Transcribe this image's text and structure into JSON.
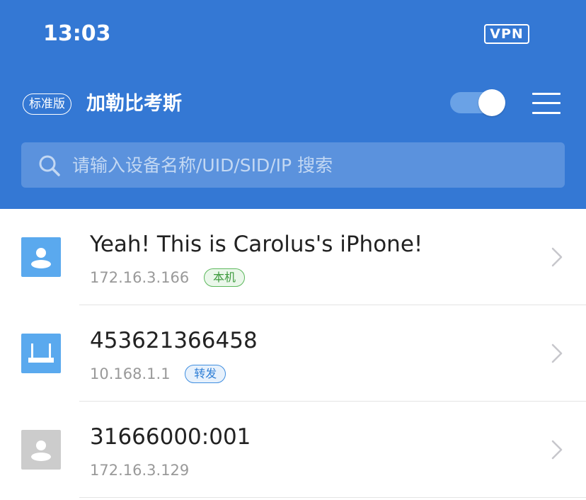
{
  "status_bar": {
    "time": "13:03",
    "vpn_label": "VPN"
  },
  "header": {
    "edition_badge": "标准版",
    "network_name": "加勒比考斯",
    "vpn_toggle_on": true
  },
  "search": {
    "placeholder": "请输入设备名称/UID/SID/IP 搜索",
    "value": ""
  },
  "devices": [
    {
      "name": "Yeah! This is Carolus's iPhone!",
      "ip": "172.16.3.166",
      "tag": "本机",
      "tag_color": "green",
      "icon": "person-icon",
      "icon_color": "#5aa9ee"
    },
    {
      "name": "453621366458",
      "ip": "10.168.1.1",
      "tag": "转发",
      "tag_color": "blue",
      "icon": "router-icon",
      "icon_color": "#5aa9ee"
    },
    {
      "name": "31666000:001",
      "ip": "172.16.3.129",
      "tag": "",
      "icon": "person-icon",
      "icon_color": "#cccccc"
    }
  ],
  "colors": {
    "header_bg": "#3478d4",
    "search_bg": "#5b92dd",
    "tag_green": "#5cb85c",
    "tag_blue": "#3f8ee0"
  }
}
